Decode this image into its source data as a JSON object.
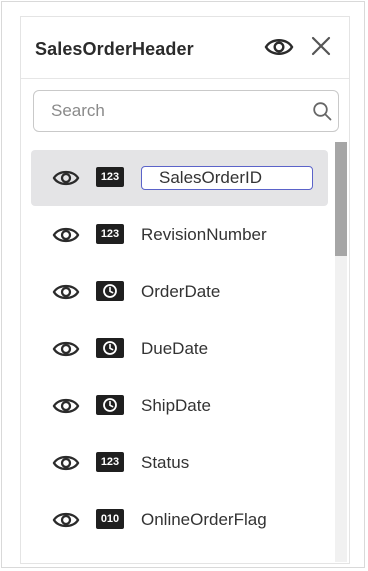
{
  "panel": {
    "title": "SalesOrderHeader",
    "header_icons": [
      "eye-icon",
      "close-icon"
    ]
  },
  "search": {
    "placeholder": "Search",
    "value": ""
  },
  "fields": [
    {
      "name": "SalesOrderID",
      "type_badge": "123",
      "type": "number",
      "selected": true,
      "editing": true
    },
    {
      "name": "RevisionNumber",
      "type_badge": "123",
      "type": "number"
    },
    {
      "name": "OrderDate",
      "type_badge": "clock",
      "type": "datetime"
    },
    {
      "name": "DueDate",
      "type_badge": "clock",
      "type": "datetime"
    },
    {
      "name": "ShipDate",
      "type_badge": "clock",
      "type": "datetime"
    },
    {
      "name": "Status",
      "type_badge": "123",
      "type": "number"
    },
    {
      "name": "OnlineOrderFlag",
      "type_badge": "010",
      "type": "boolean"
    }
  ],
  "colors": {
    "selected_row": "#e4e4e6",
    "edit_border": "#5b63c9",
    "badge_bg": "#1f1f1f",
    "scroll_thumb": "#a6a6a6"
  }
}
